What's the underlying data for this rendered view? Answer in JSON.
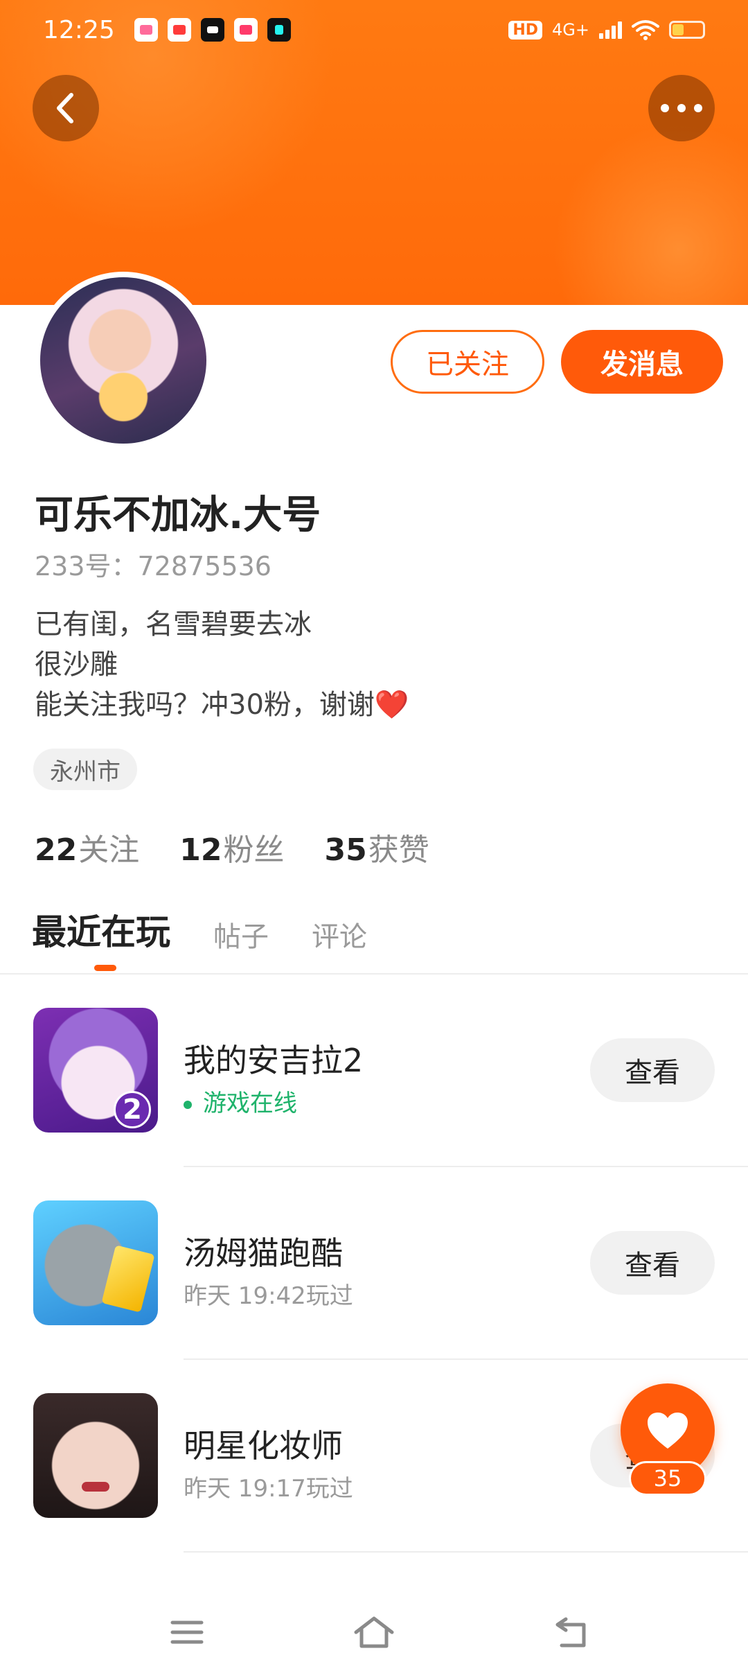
{
  "status_bar": {
    "time": "12:25",
    "network": "4G+",
    "hd": "HD",
    "app_icons": [
      "bilibili-icon",
      "video-icon",
      "capcut-icon",
      "kuaishou-icon",
      "douyin-icon"
    ]
  },
  "profile": {
    "name": "可乐不加冰.大号",
    "id_label": "233号：72875536",
    "bio": [
      "已有闺，名雪碧要去冰",
      "很沙雕",
      "能关注我吗？冲30粉，谢谢"
    ],
    "bio_emoji": "❤️",
    "location": "永州市",
    "follow_button": "已关注",
    "message_button": "发消息"
  },
  "stats": [
    {
      "value": "22",
      "label": "关注"
    },
    {
      "value": "12",
      "label": "粉丝"
    },
    {
      "value": "35",
      "label": "获赞"
    }
  ],
  "tabs": [
    "最近在玩",
    "帖子",
    "评论"
  ],
  "games": [
    {
      "title": "我的安吉拉2",
      "subtitle": "游戏在线",
      "online": true,
      "button": "查看",
      "badge": "2"
    },
    {
      "title": "汤姆猫跑酷",
      "subtitle": "昨天  19:42玩过",
      "online": false,
      "button": "查看"
    },
    {
      "title": "明星化妆师",
      "subtitle": "昨天  19:17玩过",
      "online": false,
      "button": "查看"
    }
  ],
  "like_fab": {
    "count": "35"
  },
  "colors": {
    "accent": "#ff5a0a",
    "online": "#1fb36b",
    "banner": "#ff7a12"
  }
}
